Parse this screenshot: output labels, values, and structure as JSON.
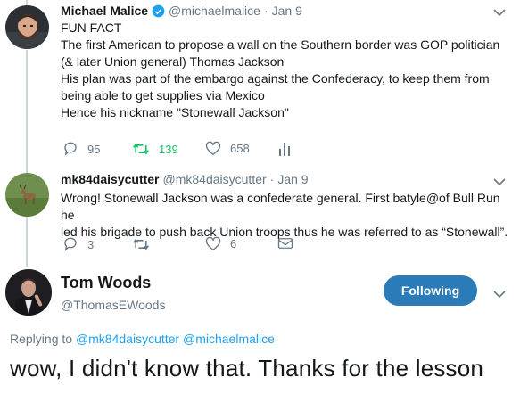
{
  "tweet1": {
    "name": "Michael Malice",
    "handle": "@michaelmalice",
    "dot": "·",
    "date": "Jan 9",
    "text": "FUN FACT\nThe first American to propose a wall on the Southern border was GOP politician\n(& later Union general) Thomas Jackson\nHis plan was part of the embargo against the Confederacy, to keep them from\nbeing able to get supplies via Mexico\nHence his nickname \"Stonewall Jackson\"",
    "replies": "95",
    "retweets": "139",
    "likes": "658",
    "verified": true,
    "retweet_color": "#17bf63"
  },
  "tweet2": {
    "name": "mk84daisycutter",
    "handle": "@mk84daisycutter",
    "dot": "·",
    "date": "Jan 9",
    "text": "Wrong! Stonewall Jackson was a confederate general. First batyle@of Bull Run he\nled his brigade to push back Union troops thus he was referred to as “Stonewall”.",
    "replies": "3",
    "retweets": "",
    "likes": "6"
  },
  "tweet3": {
    "name": "Tom Woods",
    "handle": "@ThomasEWoods",
    "follow_label": "Following",
    "replying_prefix": "Replying to",
    "replying_user1": "@mk84daisycutter",
    "replying_user2": "@michaelmalice",
    "text": "wow, I didn't know that. Thanks for the lesson"
  },
  "colors": {
    "accent": "#1da1f2",
    "follow_button": "#2b7bb9",
    "muted": "#657786",
    "icon": "#657786"
  }
}
